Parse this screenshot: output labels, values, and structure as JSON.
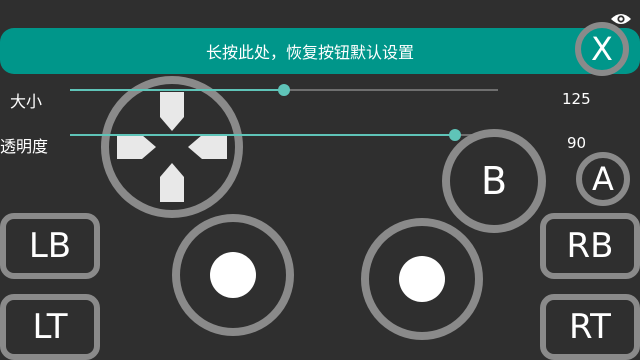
{
  "banner": {
    "text": "长按此处，恢复按钮默认设置"
  },
  "buttons": {
    "x": "X",
    "b": "B",
    "a": "A",
    "lb": "LB",
    "rb": "RB",
    "lt": "LT",
    "rt": "RT"
  },
  "sliders": {
    "size": {
      "label": "大小",
      "value": "125"
    },
    "opacity": {
      "label": "透明度",
      "value": "90"
    }
  },
  "colors": {
    "accent": "#00968a",
    "ring": "#8a8a8a",
    "slider": "#5fc4b8",
    "background": "#2f2f2f"
  },
  "icons": {
    "visibility": "eye-icon"
  }
}
